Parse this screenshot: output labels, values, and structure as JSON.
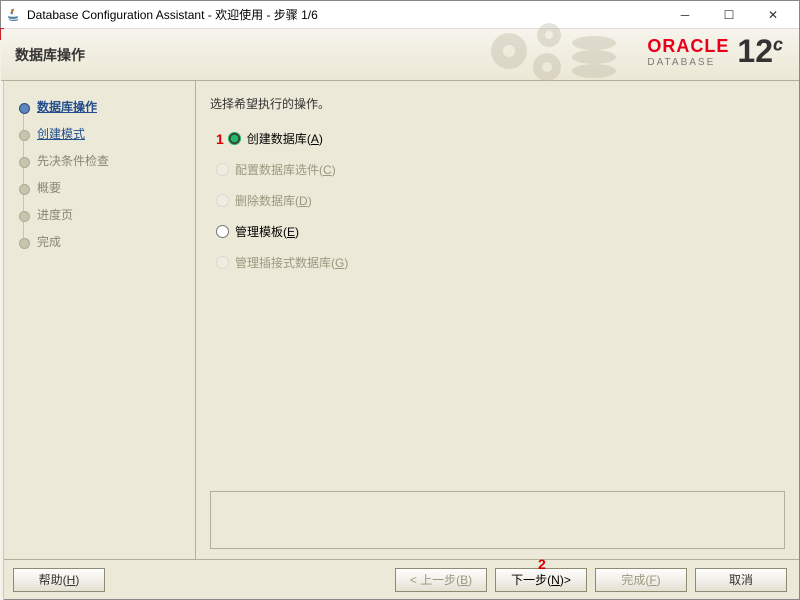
{
  "title": "Database Configuration Assistant - 欢迎使用 - 步骤 1/6",
  "header": {
    "page_title": "数据库操作"
  },
  "brand": {
    "name": "ORACLE",
    "sub": "DATABASE",
    "version_num": "12",
    "version_suffix": "c"
  },
  "sidebar": {
    "steps": [
      {
        "label": "数据库操作",
        "state": "active"
      },
      {
        "label": "创建模式",
        "state": "next"
      },
      {
        "label": "先决条件检查",
        "state": "disabled"
      },
      {
        "label": "概要",
        "state": "disabled"
      },
      {
        "label": "进度页",
        "state": "disabled"
      },
      {
        "label": "完成",
        "state": "disabled"
      }
    ]
  },
  "main": {
    "instruction": "选择希望执行的操作。",
    "options": [
      {
        "label": "创建数据库",
        "mnemonic": "A",
        "state": "selected",
        "annotation": "1"
      },
      {
        "label": "配置数据库选件",
        "mnemonic": "C",
        "state": "disabled"
      },
      {
        "label": "删除数据库",
        "mnemonic": "D",
        "state": "disabled"
      },
      {
        "label": "管理模板",
        "mnemonic": "E",
        "state": "enabled"
      },
      {
        "label": "管理插接式数据库",
        "mnemonic": "G",
        "state": "disabled"
      }
    ]
  },
  "footer": {
    "help": "帮助",
    "help_mn": "H",
    "back": "< 上一步",
    "back_mn": "B",
    "next_pre": "下一步",
    "next_mn": "N",
    "next_post": " >",
    "finish": "完成",
    "finish_mn": "F",
    "cancel": "取消",
    "next_annotation": "2"
  }
}
